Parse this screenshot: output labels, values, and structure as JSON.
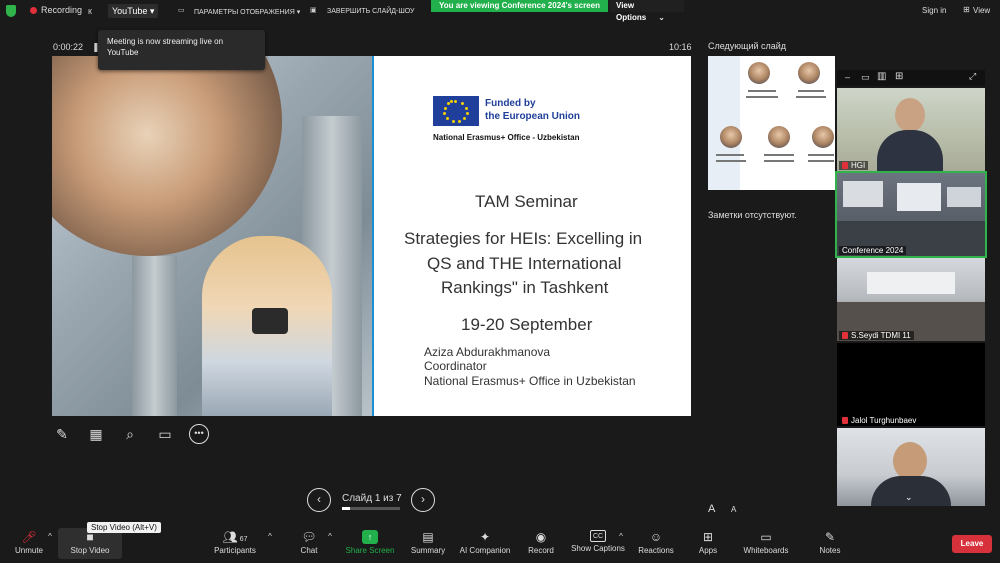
{
  "top_bar": {
    "recording_label": "Recording",
    "signal_label": "к",
    "youtube_label": "YouTube",
    "display_params_label": "ПАРАМЕТРЫ ОТОБРАЖЕНИЯ ▾",
    "end_slideshow_label": "ЗАВЕРШИТЬ СЛАЙД-ШОУ",
    "viewing_banner": "You are viewing Conference 2024's screen",
    "view_options_label": "View Options",
    "sign_in_label": "Sign in",
    "view_label": "View"
  },
  "presenter": {
    "elapsed": "0:00:22",
    "clock": "10:16",
    "toast": "Meeting is now streaming live on YouTube"
  },
  "slide": {
    "funded_line1": "Funded by",
    "funded_line2": "the European Union",
    "office": "National Erasmus+ Office - Uzbekistan",
    "seminar": "TAM Seminar",
    "title_line1": "Strategies for HEIs: Excelling in",
    "title_line2": "QS and THE International",
    "title_line3": "Rankings\" in Tashkent",
    "date": "19-20 September",
    "presenter_name": "Aziza Abdurakhmanova",
    "presenter_role": "Coordinator",
    "presenter_org": "National Erasmus+ Office in Uzbekistan"
  },
  "right_panel": {
    "next_slide_label": "Следующий слайд",
    "notes_label": "Заметки отсутствуют.",
    "font_smaller": "A",
    "font_larger": "A"
  },
  "slide_nav": {
    "counter": "Слайд 1 из 7",
    "prev_icon": "chevron-left",
    "next_icon": "chevron-right",
    "progress": 0.14
  },
  "participants": [
    {
      "name": "HGI",
      "muted": true
    },
    {
      "name": "Conference 2024",
      "muted": false
    },
    {
      "name": "S.Seydi TDMI 11",
      "muted": true
    },
    {
      "name": "Jalol Turghunbaev",
      "muted": true
    },
    {
      "name": "",
      "muted": false
    }
  ],
  "toolbar": {
    "unmute": "Unmute",
    "stop_video": "Stop Video",
    "stop_video_tooltip": "Stop Video (Alt+V)",
    "participants": "Participants",
    "participant_count": "67",
    "chat": "Chat",
    "share_screen": "Share Screen",
    "summary": "Summary",
    "ai_companion": "AI Companion",
    "record": "Record",
    "show_captions": "Show Captions",
    "reactions": "Reactions",
    "apps": "Apps",
    "whiteboards": "Whiteboards",
    "notes": "Notes",
    "leave": "Leave"
  },
  "colors": {
    "banner_green": "#21b04b",
    "leave_red": "#d7323b",
    "slide_divider_blue": "#1c8fd4",
    "eu_blue": "#1f3f9a"
  }
}
